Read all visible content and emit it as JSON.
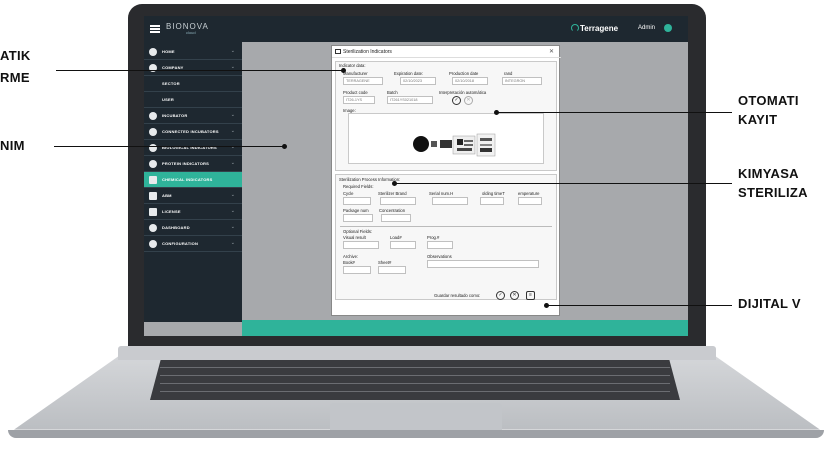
{
  "app": {
    "logo": "BIONOVA",
    "logo_sub": "cloud",
    "brand": "Terragene",
    "user": "Admin"
  },
  "sidebar": {
    "items": [
      {
        "label": "HOME"
      },
      {
        "label": "COMPANY"
      },
      {
        "label": "SECTOR"
      },
      {
        "label": "USER"
      },
      {
        "label": "INCUBATOR"
      },
      {
        "label": "CONNECTED INCUBATORS"
      },
      {
        "label": "BIOLOGICAL INDICATORS"
      },
      {
        "label": "PROTEIN INDICATORS"
      },
      {
        "label": "CHEMICAL INDICATORS"
      },
      {
        "label": "ABM"
      },
      {
        "label": "LICENSE"
      },
      {
        "label": "DASHBOARD"
      },
      {
        "label": "CONFIGURATION"
      }
    ]
  },
  "dialog": {
    "title": "Sterilization Indicators",
    "indicator_section": "Indicator data:",
    "labels": {
      "manufacturer": "Manufacturer",
      "expiration": "Expiration date:",
      "production": "Production date",
      "brand": "rand",
      "product_code": "Product code",
      "batch": "Batch",
      "interpretation": "Interpretación automática",
      "image": "Image:"
    },
    "values": {
      "manufacturer": "TERRAGENE",
      "expiration": "02/10/2023",
      "production": "02/10/2018",
      "brand": "INTEGRON",
      "product_code": "IT26-1YS",
      "batch": "IT261YS021018"
    },
    "process_section": "Sterilization Process Information:",
    "required_fields": "Required Fields:",
    "required_labels": {
      "cycle": "Cycle",
      "brand": "Sterilizer Brand",
      "serial": "Serial num.H",
      "holding": "olding timeT",
      "temperature": "emperature",
      "package": "Package num",
      "concentration": "Concentration"
    },
    "optional_fields": "Optional Fields:",
    "optional_labels": {
      "visual": "Visual result",
      "load": "Load#",
      "prog": "Prog.#",
      "archive": "Archive:",
      "book": "Book#",
      "sheet": "Sheet#",
      "observations": "Observations"
    },
    "save_as": "Guardar resultado como:"
  },
  "callouts": {
    "left_top_1": "ATIK",
    "left_top_2": "RME",
    "left_mid": "NIM",
    "right_1a": "OTOMATI",
    "right_1b": "KAYIT",
    "right_2a": "KIMYASA",
    "right_2b": "STERILIZA",
    "right_3": "DIJITAL V"
  }
}
